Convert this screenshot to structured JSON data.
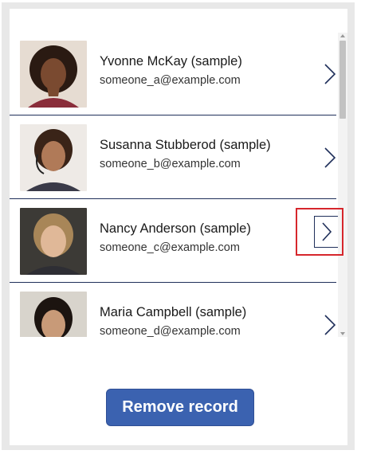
{
  "gallery": {
    "items": [
      {
        "name": "Yvonne McKay (sample)",
        "email": "someone_a@example.com"
      },
      {
        "name": "Susanna Stubberod (sample)",
        "email": "someone_b@example.com"
      },
      {
        "name": "Nancy Anderson (sample)",
        "email": "someone_c@example.com"
      },
      {
        "name": "Maria Campbell (sample)",
        "email": "someone_d@example.com"
      }
    ]
  },
  "actions": {
    "remove_label": "Remove record"
  },
  "colors": {
    "accent": "#3b62b0",
    "divider": "#1f2f5a",
    "highlight": "#d6262c"
  }
}
